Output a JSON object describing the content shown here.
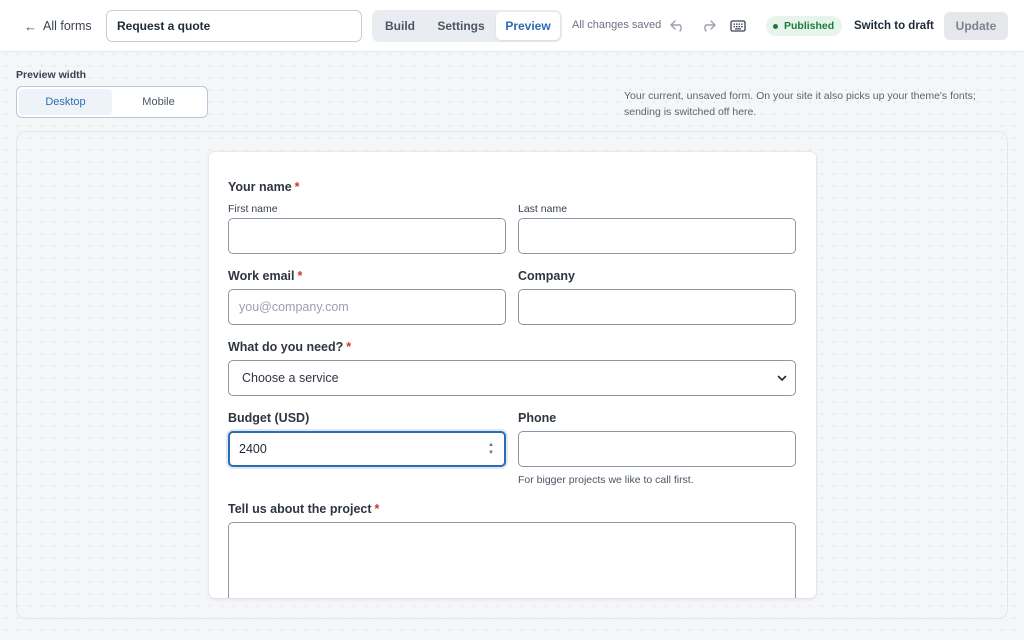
{
  "topbar": {
    "back_label": "All forms",
    "form_title": "Request a quote",
    "tabs": [
      {
        "label": "Build",
        "active": false
      },
      {
        "label": "Settings",
        "active": false
      },
      {
        "label": "Preview",
        "active": true
      }
    ],
    "save_status": "All changes saved",
    "icons": {
      "undo": "undo-icon",
      "redo": "redo-icon",
      "keyboard": "keyboard-icon"
    },
    "status_badge": "Published",
    "draft_label": "Switch to draft",
    "update_label": "Update"
  },
  "preview_width": {
    "label": "Preview width",
    "options": [
      {
        "label": "Desktop",
        "active": true
      },
      {
        "label": "Mobile",
        "active": false
      }
    ]
  },
  "note": "Your current, unsaved form. On your site it also picks up your theme's fonts; sending is switched off here.",
  "form": {
    "name": {
      "label": "Your name",
      "required_mark": "*",
      "first_label": "First name",
      "first_value": "",
      "last_label": "Last name",
      "last_value": ""
    },
    "email": {
      "label": "Work email",
      "required_mark": "*",
      "placeholder": "you@company.com",
      "value": ""
    },
    "company": {
      "label": "Company",
      "value": ""
    },
    "service": {
      "label": "What do you need?",
      "required_mark": "*",
      "selected": "Choose a service"
    },
    "budget": {
      "label": "Budget (USD)",
      "value": "2400"
    },
    "phone": {
      "label": "Phone",
      "value": "",
      "hint": "For bigger projects we like to call first."
    },
    "project": {
      "label": "Tell us about the project",
      "required_mark": "*",
      "value": ""
    }
  },
  "colors": {
    "accent": "#2c6cb0",
    "required": "#d0342c",
    "published_bg": "#e6f4ea",
    "published_text": "#1e7a3a"
  }
}
